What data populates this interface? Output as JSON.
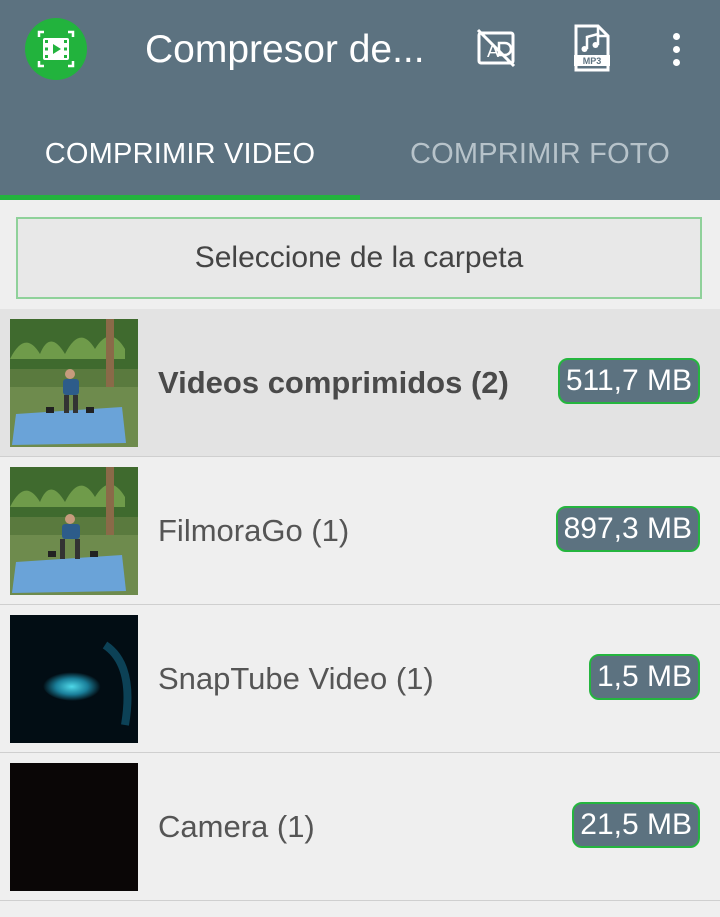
{
  "app": {
    "title": "Compresor de...",
    "icon": "video-compress-icon",
    "accent": "#23b33e",
    "toolbar_color": "#5c7280"
  },
  "toolbar": {
    "actions": [
      {
        "icon": "ad-block-icon"
      },
      {
        "icon": "mp3-file-icon",
        "label": "MP3"
      },
      {
        "icon": "more-vert-icon"
      }
    ]
  },
  "tabs": [
    {
      "label": "COMPRIMIR VIDEO",
      "active": true
    },
    {
      "label": "COMPRIMIR FOTO",
      "active": false
    }
  ],
  "folder_button": {
    "label": "Seleccione de la carpeta"
  },
  "folders": [
    {
      "name": "Videos comprimidos (2)",
      "size": "511,7 MB",
      "thumb": "outdoor-workout"
    },
    {
      "name": "FilmoraGo (1)",
      "size": "897,3 MB",
      "thumb": "outdoor-workout"
    },
    {
      "name": "SnapTube Video (1)",
      "size": "1,5 MB",
      "thumb": "dark-cyan-blur"
    },
    {
      "name": "Camera (1)",
      "size": "21,5 MB",
      "thumb": "black"
    }
  ]
}
